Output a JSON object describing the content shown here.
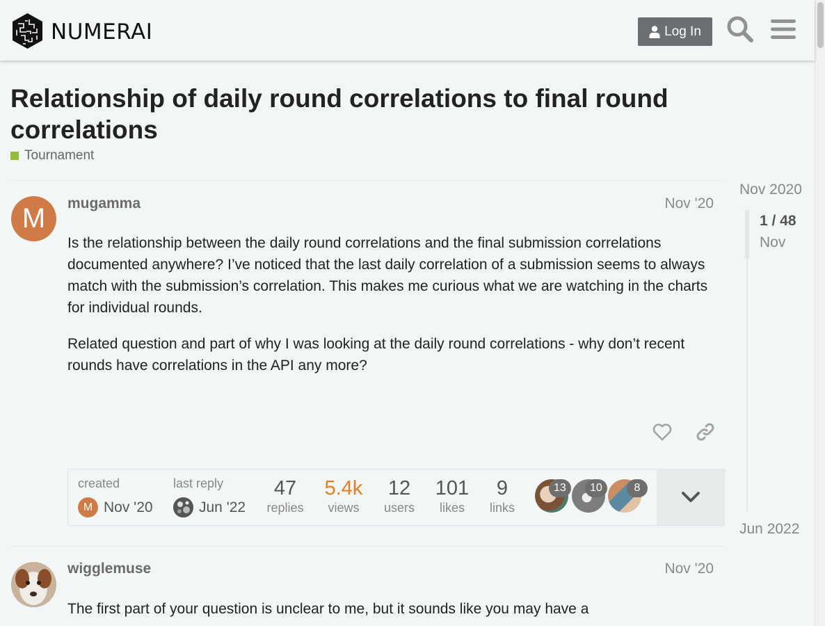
{
  "header": {
    "brand": "NUMERAI",
    "login_label": "Log In",
    "icons": [
      "numerai-logo",
      "user-icon",
      "search-icon",
      "hamburger-menu-icon"
    ]
  },
  "topic": {
    "title": "Relationship of daily round correlations to final round correlations",
    "category": "Tournament",
    "category_color": "#92bf37"
  },
  "posts": [
    {
      "username": "mugamma",
      "avatar_letter": "M",
      "avatar_color": "#d07b46",
      "date": "Nov '20",
      "paragraphs": [
        "Is the relationship between the daily round correlations and the final submission correlations documented anywhere? I’ve noticed that the last daily correlation of a submission seems to always match with the submission’s correlation. This makes me curious what we are watching in the charts for individual rounds.",
        "Related question and part of why I was looking at the daily round correlations - why don’t recent rounds have correlations in the API any more?"
      ]
    },
    {
      "username": "wigglemuse",
      "date": "Nov '20",
      "paragraphs": [
        "The first part of your question is unclear to me, but it sounds like you may have a"
      ]
    }
  ],
  "topic_map": {
    "created_label": "created",
    "created_avatar_letter": "M",
    "created_date": "Nov '20",
    "last_reply_label": "last reply",
    "last_reply_date": "Jun '22",
    "stats": [
      {
        "num": "47",
        "label": "replies"
      },
      {
        "num": "5.4k",
        "label": "views"
      },
      {
        "num": "12",
        "label": "users"
      },
      {
        "num": "101",
        "label": "likes"
      },
      {
        "num": "9",
        "label": "links"
      }
    ],
    "participants": [
      {
        "count": "13"
      },
      {
        "count": "10"
      },
      {
        "count": "8"
      }
    ],
    "views_color": "#e45735"
  },
  "timeline": {
    "start": "Nov 2020",
    "position": "1 / 48",
    "current_date": "Nov",
    "end": "Jun 2022"
  }
}
